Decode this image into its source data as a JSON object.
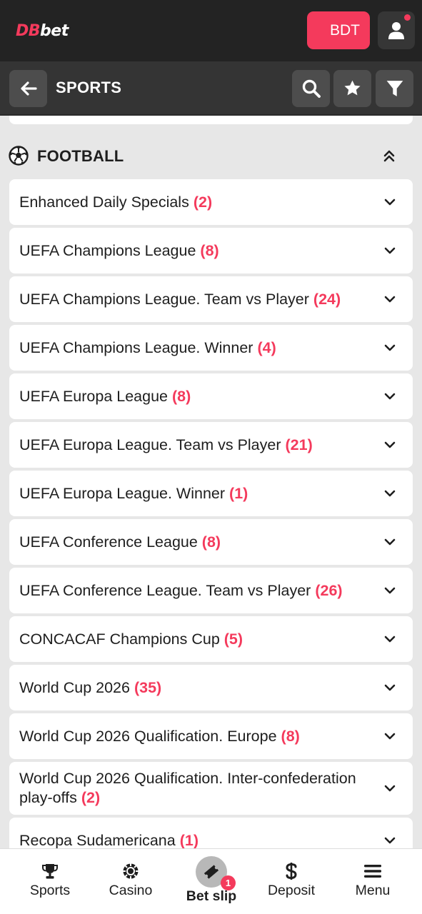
{
  "header": {
    "logo_part1": "DB",
    "logo_part2": "bet",
    "currency_label": "BDT",
    "user_icon": "user-icon",
    "notification": true
  },
  "subheader": {
    "title": "SPORTS",
    "icons": [
      "back-arrow-icon",
      "search-icon",
      "star-icon",
      "filter-icon"
    ]
  },
  "sport": {
    "name": "FOOTBALL",
    "icon": "football-icon",
    "collapse_icon": "chevrons-up-icon"
  },
  "leagues": [
    {
      "name": "Enhanced Daily Specials",
      "count": "(2)"
    },
    {
      "name": "UEFA Champions League",
      "count": "(8)"
    },
    {
      "name": "UEFA Champions League. Team vs Player",
      "count": "(24)"
    },
    {
      "name": "UEFA Champions League. Winner",
      "count": "(4)"
    },
    {
      "name": "UEFA Europa League",
      "count": "(8)"
    },
    {
      "name": "UEFA Europa League. Team vs Player",
      "count": "(21)"
    },
    {
      "name": "UEFA Europa League. Winner",
      "count": "(1)"
    },
    {
      "name": "UEFA Conference League",
      "count": "(8)"
    },
    {
      "name": "UEFA Conference League. Team vs Player",
      "count": "(26)"
    },
    {
      "name": "CONCACAF Champions Cup",
      "count": "(5)"
    },
    {
      "name": "World Cup 2026",
      "count": "(35)"
    },
    {
      "name": "World Cup 2026 Qualification. Europe",
      "count": "(8)"
    },
    {
      "name": "World Cup 2026 Qualification. Inter-confederation play-offs",
      "count": "(2)"
    },
    {
      "name": "Recopa Sudamericana",
      "count": "(1)"
    }
  ],
  "bottom_nav": {
    "sports": "Sports",
    "casino": "Casino",
    "betslip": "Bet slip",
    "betslip_count": "1",
    "deposit": "Deposit",
    "menu": "Menu"
  },
  "colors": {
    "accent": "#f43a5c",
    "topbar": "#232323",
    "subbar": "#343434",
    "background": "#e7e7e7"
  }
}
